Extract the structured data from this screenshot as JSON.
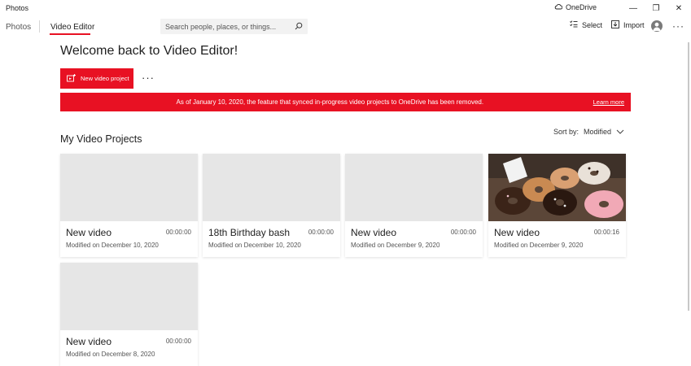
{
  "app": {
    "title": "Photos"
  },
  "onedrive": {
    "label": "OneDrive"
  },
  "window_controls": {
    "minimize": "—",
    "restore": "❐",
    "close": "✕"
  },
  "nav": {
    "tabs": [
      {
        "label": "Photos"
      },
      {
        "label": "Video Editor"
      }
    ]
  },
  "search": {
    "placeholder": "Search people, places, or things..."
  },
  "toolbar": {
    "select_label": "Select",
    "import_label": "Import",
    "more_label": "···"
  },
  "main": {
    "heading": "Welcome back to Video Editor!",
    "new_project_label": "New video project",
    "more_label": "···",
    "banner": {
      "message": "As of January 10, 2020, the feature that synced in-progress video projects to OneDrive has been removed.",
      "link": "Learn more"
    },
    "section_title": "My Video Projects",
    "sort": {
      "label": "Sort by:",
      "value": "Modified"
    }
  },
  "projects": [
    {
      "name": "New video",
      "duration": "00:00:00",
      "modified": "Modified on December 10, 2020"
    },
    {
      "name": "18th Birthday bash",
      "duration": "00:00:00",
      "modified": "Modified on December 10, 2020"
    },
    {
      "name": "New video",
      "duration": "00:00:00",
      "modified": "Modified on December 9, 2020"
    },
    {
      "name": "New video",
      "duration": "00:00:16",
      "modified": "Modified on December 9, 2020"
    },
    {
      "name": "New video",
      "duration": "00:00:00",
      "modified": "Modified on December 8, 2020"
    }
  ],
  "colors": {
    "accent": "#e81123",
    "thumb_placeholder": "#e6e6e6"
  },
  "icons": {
    "onedrive": "cloud-icon",
    "search": "search-icon",
    "select": "select-list-icon",
    "import": "import-icon",
    "new_project": "new-video-project-icon",
    "sort": "chevron-down-icon"
  }
}
